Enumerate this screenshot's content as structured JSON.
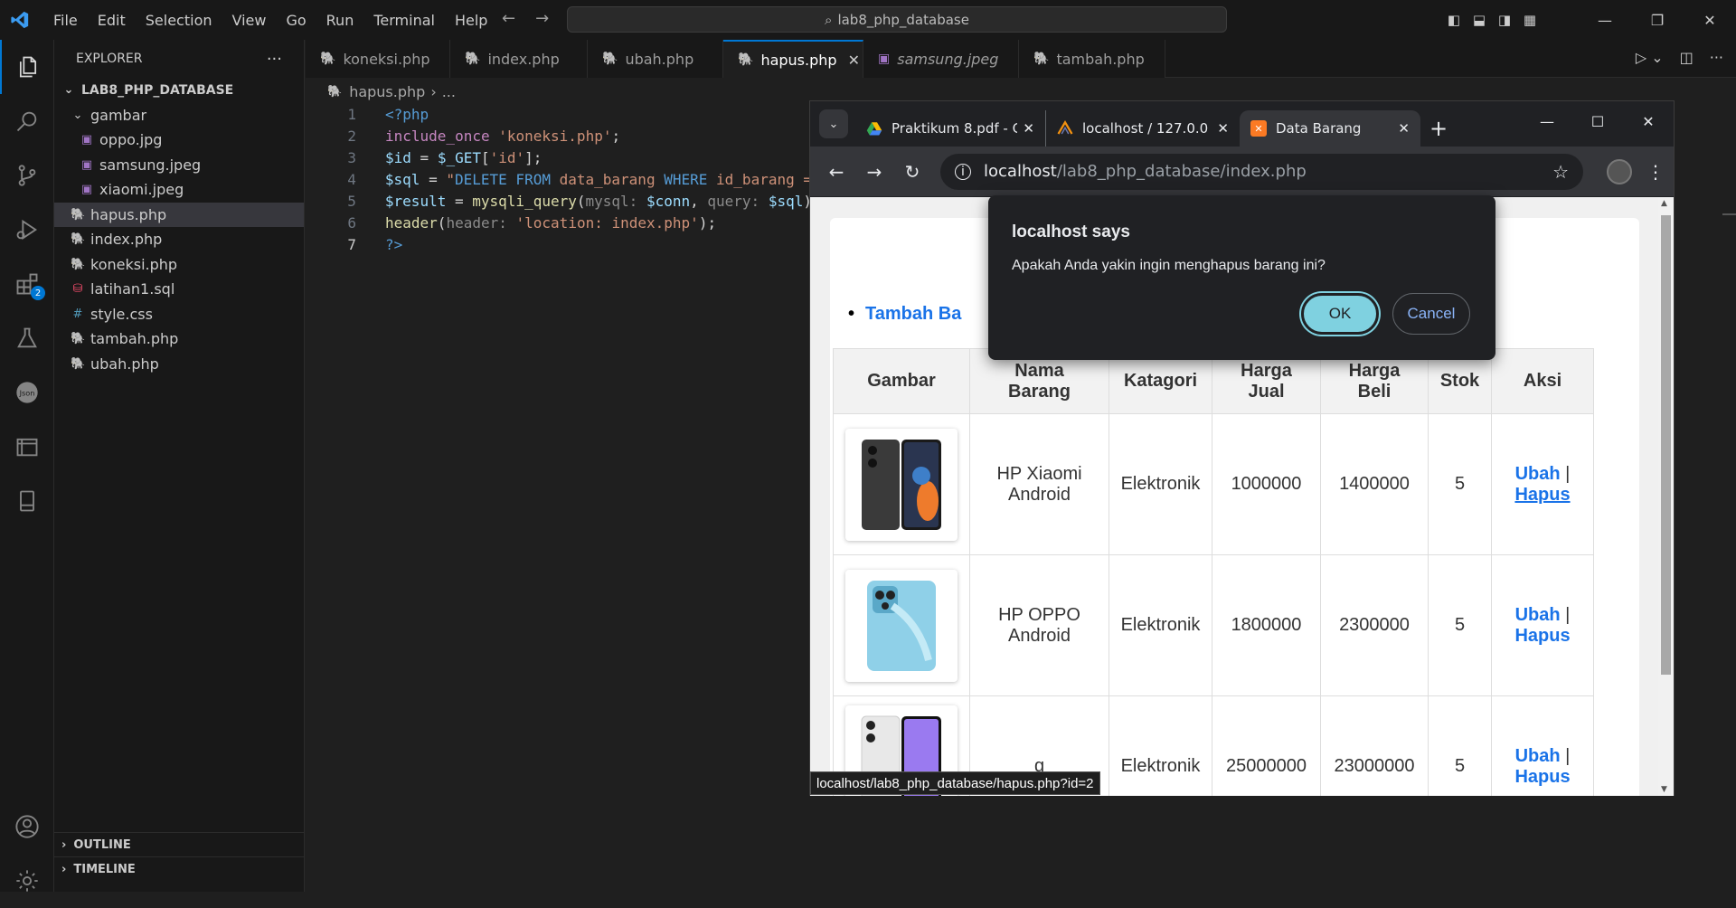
{
  "menu": [
    "File",
    "Edit",
    "Selection",
    "View",
    "Go",
    "Run",
    "Terminal",
    "Help"
  ],
  "command_center": "lab8_php_database",
  "explorer": {
    "title": "EXPLORER",
    "root": "LAB8_PHP_DATABASE",
    "folder": "gambar",
    "folder_files": [
      "oppo.jpg",
      "samsung.jpeg",
      "xiaomi.jpeg"
    ],
    "files": [
      "hapus.php",
      "index.php",
      "koneksi.php",
      "latihan1.sql",
      "style.css",
      "tambah.php",
      "ubah.php"
    ],
    "outline": "OUTLINE",
    "timeline": "TIMELINE"
  },
  "activity_badge": "2",
  "tabs": [
    {
      "label": "koneksi.php"
    },
    {
      "label": "index.php"
    },
    {
      "label": "ubah.php"
    },
    {
      "label": "hapus.php"
    },
    {
      "label": "samsung.jpeg"
    },
    {
      "label": "tambah.php"
    }
  ],
  "breadcrumb": {
    "file": "hapus.php",
    "rest": "..."
  },
  "code_lines": [
    "1",
    "2",
    "3",
    "4",
    "5",
    "6",
    "7"
  ],
  "browser": {
    "tabs": [
      {
        "label": "Praktikum 8.pdf - G"
      },
      {
        "label": "localhost / 127.0.0"
      },
      {
        "label": "Data Barang"
      }
    ],
    "url_host": "localhost",
    "url_path": "/lab8_php_database/index.php",
    "status_url": "localhost/lab8_php_database/hapus.php?id=2"
  },
  "page": {
    "add_link": "Tambah Ba",
    "headers": [
      "Gambar",
      "Nama Barang",
      "Katagori",
      "Harga Jual",
      "Harga Beli",
      "Stok",
      "Aksi"
    ],
    "rows": [
      {
        "nama": "HP Xiaomi Android",
        "kategori": "Elektronik",
        "jual": "1000000",
        "beli": "1400000",
        "stok": "5",
        "ubah": "Ubah",
        "hapus": "Hapus"
      },
      {
        "nama": "HP OPPO Android",
        "kategori": "Elektronik",
        "jual": "1800000",
        "beli": "2300000",
        "stok": "5",
        "ubah": "Ubah",
        "hapus": "Hapus"
      },
      {
        "nama": "g",
        "kategori": "Elektronik",
        "jual": "25000000",
        "beli": "23000000",
        "stok": "5",
        "ubah": "Ubah",
        "hapus": "Hapus"
      }
    ]
  },
  "dialog": {
    "title": "localhost says",
    "message": "Apakah Anda yakin ingin menghapus barang ini?",
    "ok": "OK",
    "cancel": "Cancel"
  }
}
